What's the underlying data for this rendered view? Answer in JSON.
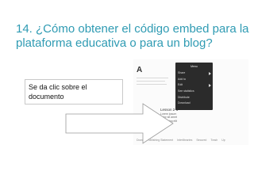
{
  "slide": {
    "title": "14. ¿Cómo obtener el código embed para la plataforma educativa o para un blog?",
    "callout": "Se da clic sobre el documento"
  },
  "screenshot": {
    "doc_letter": "A",
    "menu_title": "Menu",
    "menu_items": [
      "Share",
      "Add to",
      "Edit",
      "See statistics",
      "Distribute",
      "Download"
    ],
    "snippet_title": "Lesson 2-1",
    "snippet_lines": [
      "Lorem ipsum",
      "dolor sit amet",
      "adipiscing elit"
    ],
    "bottom_tabs": [
      "Docs",
      "Publishing Statement",
      "Interlibraries",
      "Secured",
      "Trash",
      "Up"
    ]
  },
  "colors": {
    "title": "#2f9bb3",
    "arrow_stroke": "#9a9a9a",
    "menu_bg": "#2b2b2b"
  }
}
